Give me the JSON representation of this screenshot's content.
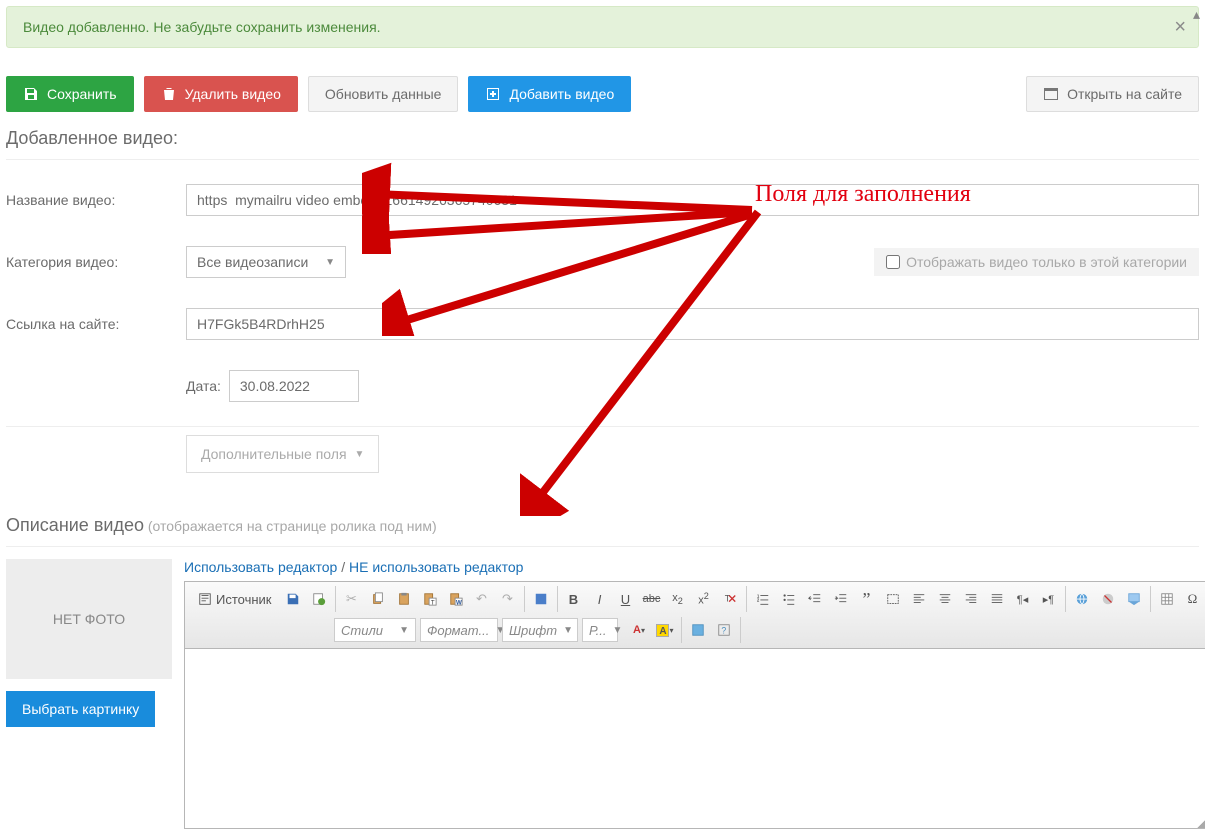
{
  "alert": {
    "message": "Видео добавленно. Не забудьте сохранить изменения.",
    "close": "×"
  },
  "toolbar": {
    "save": "Сохранить",
    "delete": "Удалить видео",
    "refresh": "Обновить данные",
    "add": "Добавить видео",
    "open": "Открыть на сайте"
  },
  "sections": {
    "added_video": "Добавленное видео:",
    "description": "Описание видео",
    "description_sub": "(отображается на странице ролика под ним)"
  },
  "labels": {
    "name": "Название видео:",
    "category": "Категория видео:",
    "sitelink": "Ссылка на сайте:",
    "date": "Дата:",
    "extra": "Дополнительные поля",
    "display_only": "Отображать видео только в этой категории"
  },
  "values": {
    "name": "https  mymailru video embed -16614926365740631",
    "category": "Все видеозаписи",
    "sitelink": "H7FGk5B4RDrhH25",
    "date": "30.08.2022"
  },
  "photo": {
    "placeholder": "НЕТ ФОТО",
    "choose": "Выбрать картинку"
  },
  "editor": {
    "use": "Использовать редактор",
    "slash": " / ",
    "nouse": "НЕ использовать редактор",
    "source": "Источник",
    "combos": {
      "styles": "Стили",
      "format": "Формат...",
      "font": "Шрифт",
      "size": "Р..."
    }
  },
  "annotation": "Поля для заполнения",
  "caret": "▼"
}
